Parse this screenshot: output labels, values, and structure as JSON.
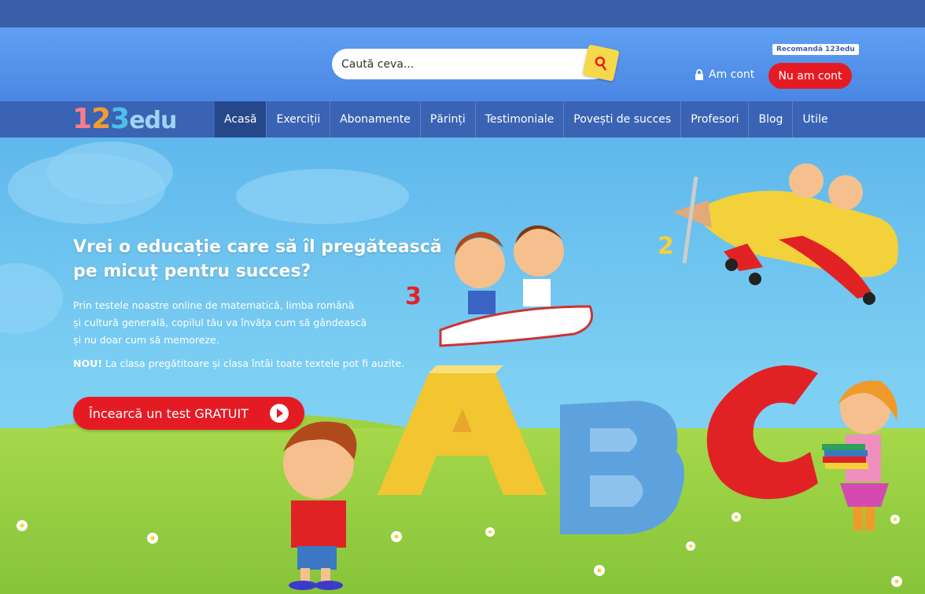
{
  "header": {
    "search": {
      "placeholder": "Caută ceva..."
    },
    "search_button_icon": "search-icon",
    "recommend_label": "Recomandă 123edu",
    "login_label": "Am cont",
    "login_icon": "lock-icon",
    "register_label": "Nu am cont"
  },
  "nav": {
    "logo": {
      "part1": "1",
      "part2": "2",
      "part3": "3",
      "part4": "edu"
    },
    "items": [
      {
        "label": "Acasă",
        "active": true
      },
      {
        "label": "Exerciții",
        "active": false
      },
      {
        "label": "Abonamente",
        "active": false
      },
      {
        "label": "Părinți",
        "active": false
      },
      {
        "label": "Testimoniale",
        "active": false
      },
      {
        "label": "Povești de succes",
        "active": false
      },
      {
        "label": "Profesori",
        "active": false
      },
      {
        "label": "Blog",
        "active": false
      },
      {
        "label": "Utile",
        "active": false
      }
    ]
  },
  "hero": {
    "title_line1": "Vrei o educație care să îl pregătească",
    "title_line2": "pe micuț pentru succes?",
    "para_line1": "Prin testele noastre online de matematică, limba română",
    "para_line2": "și cultură generală, copilul tău va învăța cum să gândească",
    "para_line3": "și nu doar cum să memoreze.",
    "new_badge": "NOU!",
    "new_text": " La clasa pregătitoare și clasa întâi toate textele pot fi auzite.",
    "cta_label": "Încearcă un test GRATUIT",
    "illustration": {
      "number_left": "3",
      "number_plane": "2",
      "letters": [
        "A",
        "B",
        "C"
      ]
    }
  },
  "colors": {
    "top_strip": "#3a5eaa",
    "nav_bg": "#3a63b4",
    "nav_active": "#26478a",
    "accent_red": "#e51b24",
    "search_yellow": "#f6d94a"
  }
}
